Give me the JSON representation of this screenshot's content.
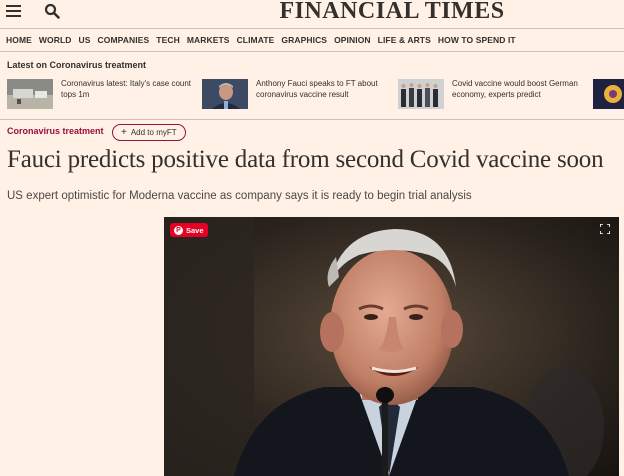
{
  "masthead": "FINANCIAL TIMES",
  "nav": [
    "HOME",
    "WORLD",
    "US",
    "COMPANIES",
    "TECH",
    "MARKETS",
    "CLIMATE",
    "GRAPHICS",
    "OPINION",
    "LIFE & ARTS",
    "HOW TO SPEND IT"
  ],
  "latest": {
    "title": "Latest on Coronavirus treatment",
    "stories": [
      {
        "text": "Coronavirus latest: Italy's case count tops 1m"
      },
      {
        "text": "Anthony Fauci speaks to FT about coronavirus vaccine result"
      },
      {
        "text": "Covid vaccine would boost German economy, experts predict"
      }
    ]
  },
  "article": {
    "topic": "Coronavirus treatment",
    "add_label": "Add to myFT",
    "headline": "Fauci predicts positive data from second Covid vaccine soon",
    "standfirst": "US expert optimistic for Moderna vaccine as company says it is ready to begin trial analysis",
    "save_label": "Save"
  },
  "colors": {
    "background": "#fff1e5",
    "claret": "#990f3d",
    "text": "#33302e",
    "pinterest": "#e60023"
  },
  "icons": [
    "menu-icon",
    "search-icon",
    "plus-icon",
    "pinterest-icon",
    "expand-icon"
  ]
}
